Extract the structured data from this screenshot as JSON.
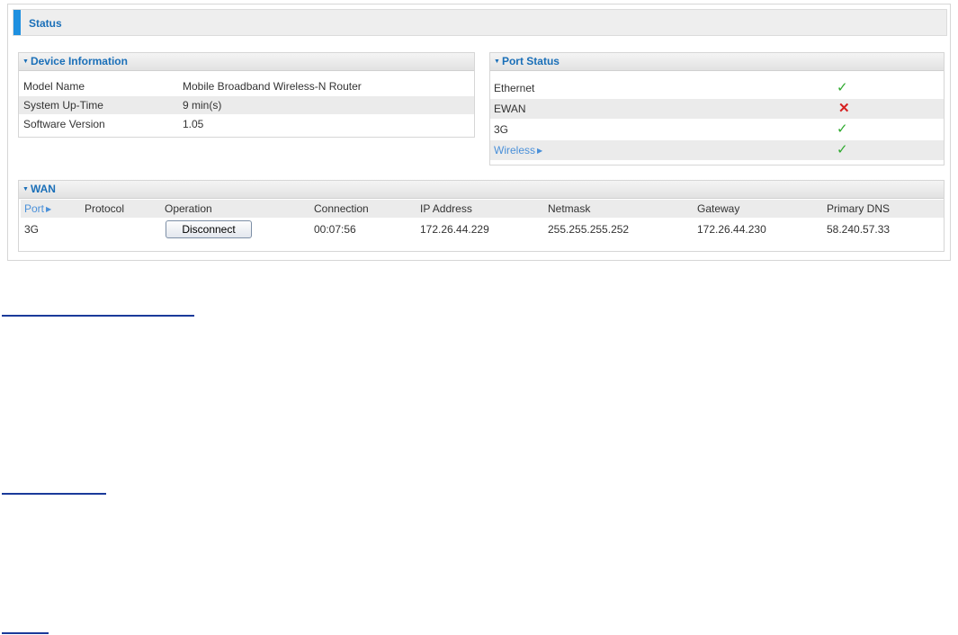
{
  "status": {
    "title": "Status"
  },
  "device_info": {
    "title": "Device Information",
    "rows": [
      {
        "label": "Model Name",
        "value": "Mobile Broadband Wireless-N Router"
      },
      {
        "label": "System Up-Time",
        "value": "9 min(s)"
      },
      {
        "label": "Software Version",
        "value": "1.05"
      }
    ]
  },
  "port_status": {
    "title": "Port Status",
    "rows": [
      {
        "label": "Ethernet",
        "state": "✓",
        "state_icon": "check-icon"
      },
      {
        "label": "EWAN",
        "state": "✕",
        "state_icon": "cross-icon"
      },
      {
        "label": "3G",
        "state": "✓",
        "state_icon": "check-icon"
      },
      {
        "label": "Wireless",
        "state": "✓",
        "state_icon": "check-icon",
        "link": true
      }
    ]
  },
  "wan": {
    "title": "WAN",
    "columns": [
      "Port",
      "Protocol",
      "Operation",
      "Connection",
      "IP Address",
      "Netmask",
      "Gateway",
      "Primary DNS"
    ],
    "row": {
      "port": "3G",
      "protocol": "",
      "operation_button": "Disconnect",
      "connection": "00:07:56",
      "ip_address": "172.26.44.229",
      "netmask": "255.255.255.252",
      "gateway": "172.26.44.230",
      "primary_dns": "58.240.57.33"
    }
  },
  "colors": {
    "accent": "#1e90e0",
    "heading": "#1a6fb8",
    "ok": "#2faa2f",
    "error": "#d62020",
    "link": "#4a90d9"
  }
}
